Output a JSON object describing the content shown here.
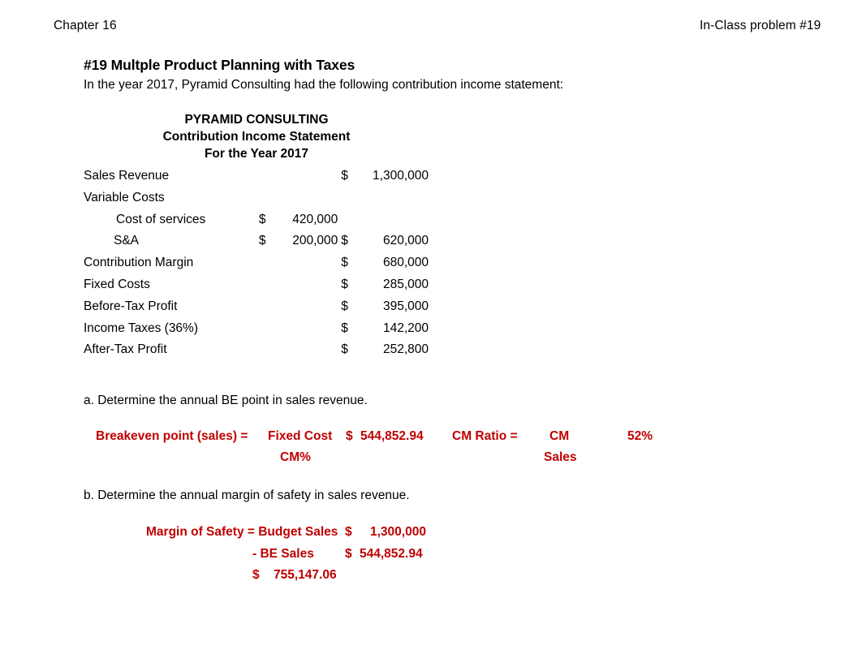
{
  "header": {
    "left": "Chapter 16",
    "right": "In-Class problem #19"
  },
  "title": "#19 Multple Product Planning with Taxes",
  "intro": "In the year 2017, Pyramid Consulting had the following contribution income statement:",
  "statement": {
    "heading_line1": "PYRAMID CONSULTING",
    "heading_line2": "Contribution Income Statement",
    "heading_line3": "For the Year 2017",
    "rows": [
      {
        "label": "Sales Revenue",
        "dollar1": "",
        "amount1": "",
        "dollar2": "$",
        "amount2": "1,300,000",
        "indent": 0
      },
      {
        "label": "Variable Costs",
        "dollar1": "",
        "amount1": "",
        "dollar2": "",
        "amount2": "",
        "indent": 0
      },
      {
        "label": "Cost of services",
        "dollar1": "$",
        "amount1": "420,000",
        "dollar2": "",
        "amount2": "",
        "indent": 1
      },
      {
        "label": "S&A",
        "dollar1": "$",
        "amount1": "200,000",
        "dollar2": "$",
        "amount2": "620,000",
        "indent": 2
      },
      {
        "label": "Contribution Margin",
        "dollar1": "",
        "amount1": "",
        "dollar2": "$",
        "amount2": "680,000",
        "indent": 0
      },
      {
        "label": "Fixed Costs",
        "dollar1": "",
        "amount1": "",
        "dollar2": "$",
        "amount2": "285,000",
        "indent": 0
      },
      {
        "label": "Before-Tax Profit",
        "dollar1": "",
        "amount1": "",
        "dollar2": "$",
        "amount2": "395,000",
        "indent": 0
      },
      {
        "label": "Income Taxes (36%)",
        "dollar1": "",
        "amount1": "",
        "dollar2": "$",
        "amount2": "142,200",
        "indent": 0
      },
      {
        "label": "After-Tax Profit",
        "dollar1": "",
        "amount1": "",
        "dollar2": "$",
        "amount2": "252,800",
        "indent": 0
      }
    ]
  },
  "question_a": {
    "prompt": "a. Determine the annual BE point in sales revenue.",
    "breakeven": {
      "label": "Breakeven point (sales) =",
      "numerator": "Fixed Cost",
      "denominator": "CM%",
      "dollar": "$",
      "value": "544,852.94"
    },
    "cm_ratio": {
      "label": "CM Ratio =",
      "numerator": "CM",
      "denominator": "Sales",
      "percent": "52%"
    }
  },
  "question_b": {
    "prompt": "b. Determine the annual margin of safety in sales revenue.",
    "margin_of_safety": {
      "label": "Margin of Safety = Budget Sales",
      "budget_dollar": "$",
      "budget_value": "1,300,000",
      "minus_label": "- BE Sales",
      "be_dollar": "$",
      "be_value": "544,852.94",
      "result_dollar": "$",
      "result_value": "755,147.06"
    }
  },
  "colors": {
    "accent_red": "#C00000",
    "text": "#000000",
    "background": "#FFFFFF"
  }
}
